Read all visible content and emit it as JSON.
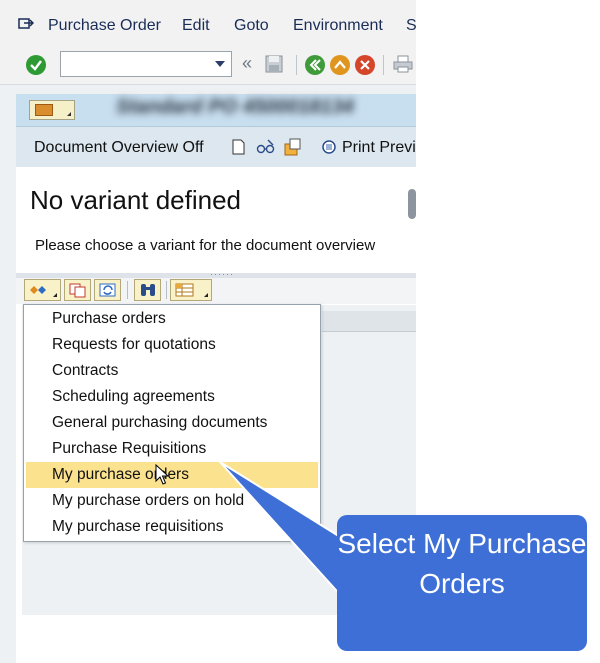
{
  "menubar": {
    "items": [
      "Purchase Order",
      "Edit",
      "Goto",
      "Environment",
      "S"
    ]
  },
  "toolbar": {
    "command_value": "",
    "back_glyph": "«"
  },
  "title_bar": {
    "title_obscured": "Standard PO 4500018134"
  },
  "app_toolbar": {
    "doc_overview_label": "Document Overview Off",
    "print_preview_label": "Print Previ"
  },
  "content": {
    "title": "No variant defined",
    "hint": "Please choose a variant for the document overview"
  },
  "dropdown": {
    "items": [
      "Purchase orders",
      "Requests for quotations",
      "Contracts",
      "Scheduling agreements",
      "General purchasing documents",
      "Purchase Requisitions",
      "My purchase orders",
      "My purchase orders on hold",
      "My purchase requisitions"
    ],
    "highlighted_index": 6
  },
  "callout": {
    "text": "Select My Purchase Orders",
    "color": "#3d6fd6"
  },
  "colors": {
    "highlight": "#fbe28e",
    "title_bar": "#c8dff0",
    "menu_text": "#1a2d57"
  },
  "icons": [
    "system-menu-icon",
    "enter-check-icon",
    "save-icon",
    "back-icon",
    "exit-icon",
    "cancel-icon",
    "print-icon",
    "variant-icon",
    "new-document-icon",
    "glasses-icon",
    "other-document-icon",
    "print-preview-icon",
    "select-variant-icon",
    "copy-icon",
    "refresh-icon",
    "binoculars-icon",
    "layout-icon",
    "mouse-cursor-icon"
  ]
}
